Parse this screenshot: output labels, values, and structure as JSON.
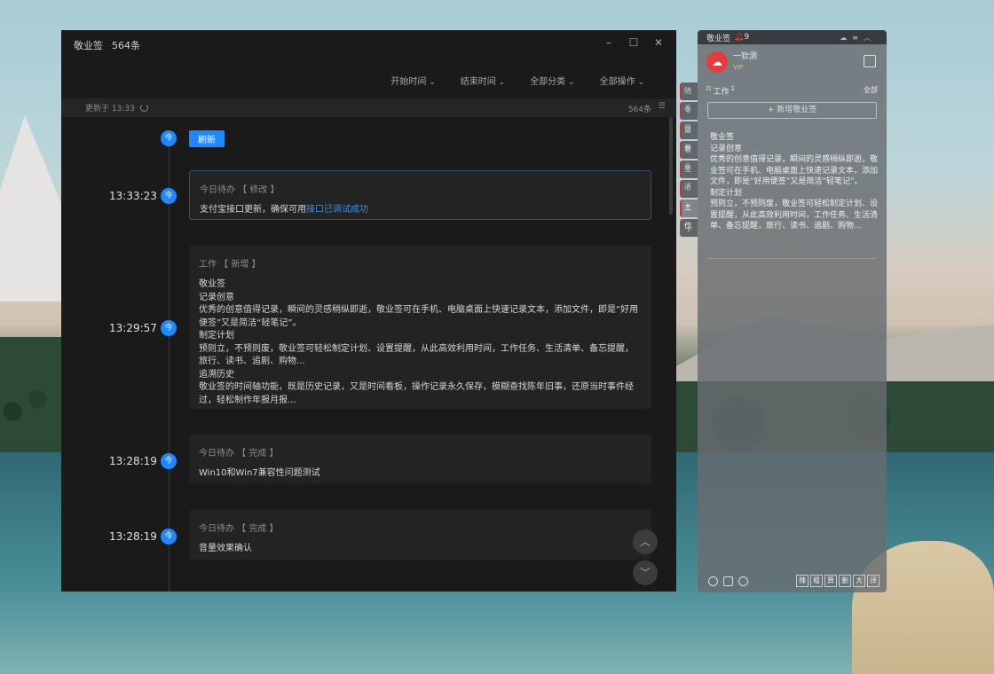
{
  "main": {
    "title": "敬业签",
    "count": "564条",
    "filters": [
      "开始时间",
      "结束时间",
      "全部分类",
      "全部操作"
    ],
    "updated": "更新于 13:33",
    "total": "564条",
    "refresh_label": "刷新",
    "today_badge": "今",
    "entries": [
      {
        "time": "13:33:23",
        "header": "今日待办 【 修改 】",
        "body": "支付宝接口更新，确保可用",
        "link": "接口已调试成功"
      },
      {
        "time": "13:29:57",
        "header": "工作 【 新增 】",
        "body": "敬业签\n记录创意\n优秀的创意值得记录，瞬间的灵感稍纵即逝，敬业签可在手机、电脑桌面上快速记录文本，添加文件，即是“好用便签”又是简洁“轻笔记”。\n制定计划\n预则立，不预则废，敬业签可轻松制定计划、设置提醒，从此高效利用时间，工作任务、生活清单、备忘提醒，旅行、读书、追剧、购物...\n追溯历史\n敬业签的时间轴功能，既是历史记录，又是时间看板，操作记录永久保存，模糊查找陈年旧事，还原当时事件经过，轻松制作年报月报..."
      },
      {
        "time": "13:28:19",
        "header": "今日待办 【 完成 】",
        "body": "Win10和Win7兼容性问题测试"
      },
      {
        "time": "13:28:19",
        "header": "今日待办 【 完成 】",
        "body": "音量效果确认"
      }
    ]
  },
  "sidebar": {
    "app_name": "敬业签",
    "bell_count": "9",
    "username": "一钦测",
    "vip": "VIP",
    "category": "工作",
    "category_count": "1",
    "filter_all": "全部",
    "new_button": "+ 新增敬业签",
    "note": "敬业签\n记录创意\n优秀的创意值得记录，瞬间的灵感稍纵即逝，敬业签可在手机、电脑桌面上快速记录文本，添加文件，即是“好用便签”又是简洁“轻笔记”。\n制定计划\n预则立，不预则废，敬业签可轻松制定计划、设置提醒，从此高效利用时间，工作任务、生活清单、备忘提醒，旅行、读书、追剧、购物...",
    "tabs": [
      "随手",
      "今日",
      "重要",
      "着急",
      "生活",
      "个人",
      "工作",
      "+"
    ],
    "format_buttons": [
      "辣",
      "粗",
      "算",
      "删",
      "大",
      "译"
    ]
  }
}
